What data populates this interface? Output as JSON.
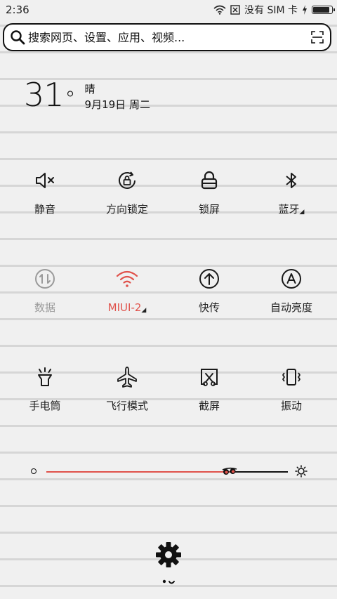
{
  "status_bar": {
    "time": "2:36",
    "sim_text": "没有 SIM 卡",
    "battery_level": 0.9
  },
  "search": {
    "placeholder": "搜索网页、设置、应用、视频..."
  },
  "weather": {
    "temperature": "31",
    "degree_symbol": "°",
    "condition": "晴",
    "date": "9月19日 周二"
  },
  "tiles": [
    {
      "label": "静音",
      "icon": "mute-icon",
      "state": "normal"
    },
    {
      "label": "方向锁定",
      "icon": "rotation-lock-icon",
      "state": "normal"
    },
    {
      "label": "锁屏",
      "icon": "lock-icon",
      "state": "normal"
    },
    {
      "label": "蓝牙",
      "icon": "bluetooth-icon",
      "state": "normal",
      "expandable": true
    },
    {
      "label": "数据",
      "icon": "mobile-data-icon",
      "state": "disabled"
    },
    {
      "label": "MIUI-2",
      "icon": "wifi-icon",
      "state": "active",
      "expandable": true
    },
    {
      "label": "快传",
      "icon": "quick-transfer-icon",
      "state": "normal"
    },
    {
      "label": "自动亮度",
      "icon": "auto-brightness-icon",
      "state": "normal"
    },
    {
      "label": "手电筒",
      "icon": "flashlight-icon",
      "state": "normal"
    },
    {
      "label": "飞行模式",
      "icon": "airplane-icon",
      "state": "normal"
    },
    {
      "label": "截屏",
      "icon": "screenshot-icon",
      "state": "normal"
    },
    {
      "label": "振动",
      "icon": "vibrate-icon",
      "state": "normal"
    }
  ],
  "brightness": {
    "level": 0.76
  },
  "colors": {
    "accent": "#e0524b",
    "text": "#222222",
    "disabled": "#9a9a9a"
  }
}
